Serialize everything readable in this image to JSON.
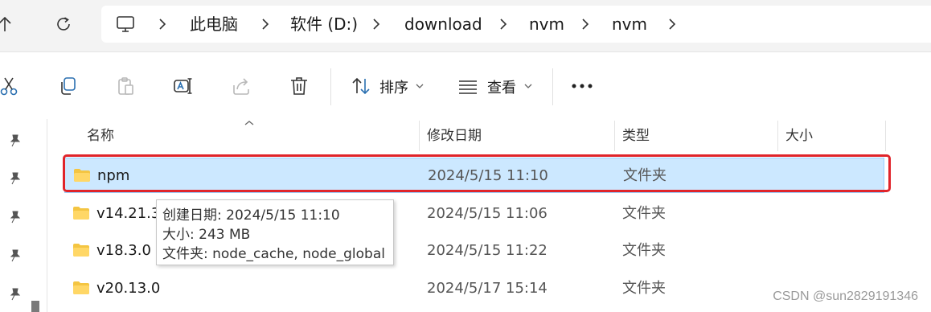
{
  "breadcrumb": [
    "此电脑",
    "软件 (D:)",
    "download",
    "nvm",
    "nvm"
  ],
  "toolbar": {
    "sort_label": "排序",
    "view_label": "查看"
  },
  "columns": {
    "name": "名称",
    "modified": "修改日期",
    "type": "类型",
    "size": "大小"
  },
  "rows": [
    {
      "name": "npm",
      "modified": "2024/5/15 11:10",
      "type": "文件夹",
      "selected": true
    },
    {
      "name": "v14.21.3",
      "modified": "2024/5/15 11:06",
      "type": "文件夹"
    },
    {
      "name": "v18.3.0",
      "modified": "2024/5/15 11:22",
      "type": "文件夹"
    },
    {
      "name": "v20.13.0",
      "modified": "2024/5/17 15:14",
      "type": "文件夹"
    }
  ],
  "tooltip": {
    "created": "创建日期: 2024/5/15 11:10",
    "size": "大小: 243 MB",
    "folders": "文件夹: node_cache, node_global"
  },
  "watermark": "CSDN @sun2829191346",
  "colors": {
    "selection": "#cce8ff",
    "highlight_box": "#e0242a",
    "folder": "#f4c542"
  }
}
